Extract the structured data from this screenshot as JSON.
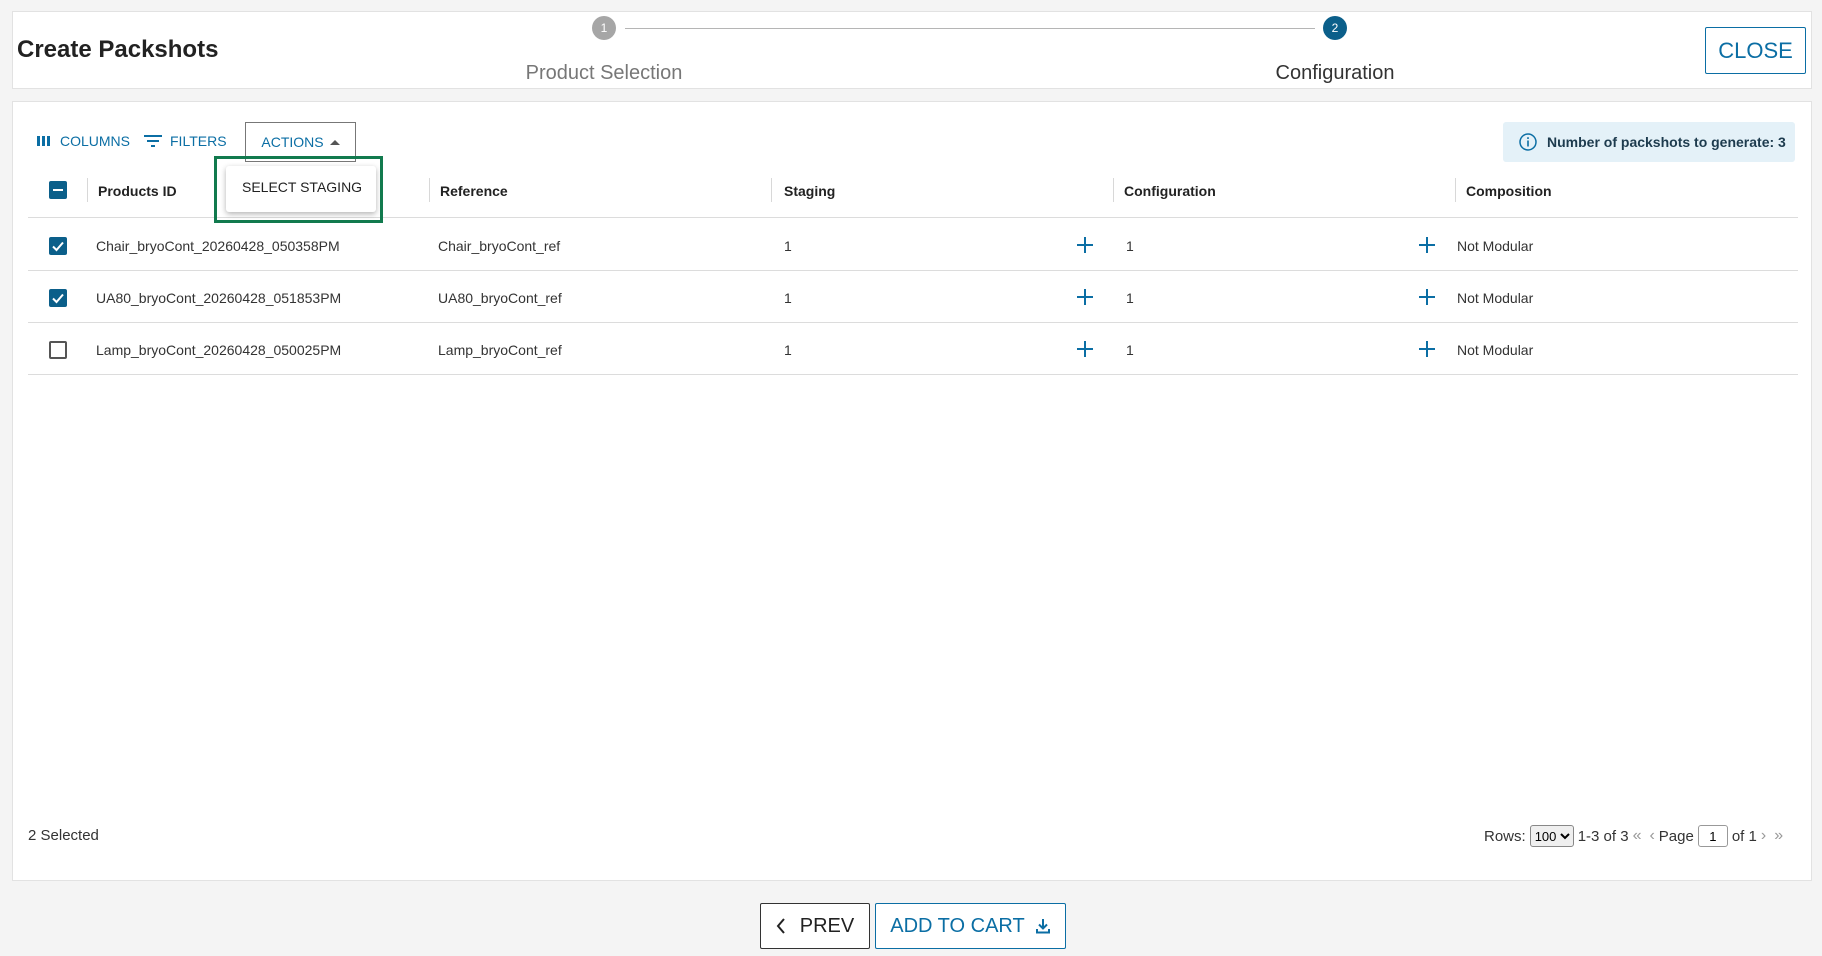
{
  "header": {
    "title": "Create Packshots",
    "close_label": "CLOSE",
    "steps": [
      {
        "number": "1",
        "label": "Product Selection"
      },
      {
        "number": "2",
        "label": "Configuration"
      }
    ]
  },
  "toolbar": {
    "columns_label": "COLUMNS",
    "filters_label": "FILTERS",
    "actions_label": "ACTIONS",
    "actions_menu": [
      "SELECT STAGING"
    ],
    "info_text": "Number of packshots to generate: 3"
  },
  "table": {
    "columns": [
      "Products ID",
      "Reference",
      "Staging",
      "Configuration",
      "Composition"
    ],
    "rows": [
      {
        "checked": true,
        "product_id": "Chair_bryoCont_20260428_050358PM",
        "reference": "Chair_bryoCont_ref",
        "staging": "1",
        "configuration": "1",
        "composition": "Not Modular"
      },
      {
        "checked": true,
        "product_id": "UA80_bryoCont_20260428_051853PM",
        "reference": "UA80_bryoCont_ref",
        "staging": "1",
        "configuration": "1",
        "composition": "Not Modular"
      },
      {
        "checked": false,
        "product_id": "Lamp_bryoCont_20260428_050025PM",
        "reference": "Lamp_bryoCont_ref",
        "staging": "1",
        "configuration": "1",
        "composition": "Not Modular"
      }
    ]
  },
  "footer": {
    "selected_text": "2 Selected",
    "rows_label": "Rows:",
    "rows_value": "100",
    "range_text": "1-3 of 3",
    "page_label": "Page",
    "page_value": "1",
    "of_text": "of 1"
  },
  "actions": {
    "prev_label": "PREV",
    "add_to_cart_label": "ADD TO CART"
  },
  "colors": {
    "accent": "#0b6ea4",
    "highlight": "#117a4e"
  }
}
